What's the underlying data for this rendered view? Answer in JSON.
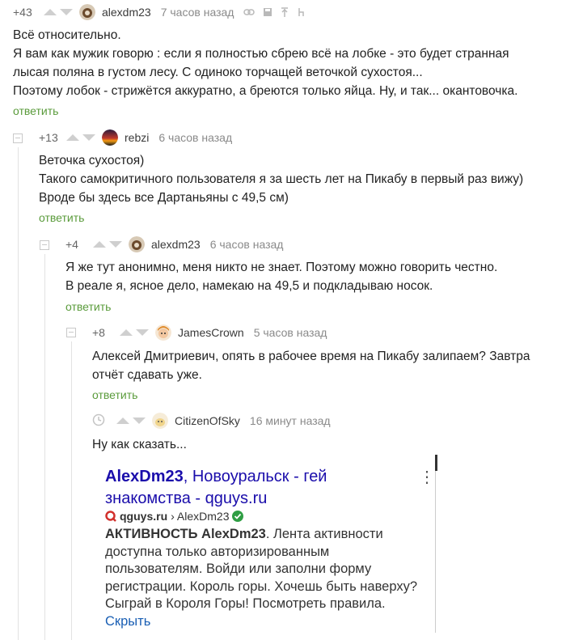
{
  "comments": [
    {
      "rating": "+43",
      "user": "alexdm23",
      "time": "7 часов назад",
      "lines": [
        "Всё относительно.",
        "Я вам как мужик говорю : если я полностью сбрею всё на лобке - это будет странная",
        "лысая поляна в густом лесу. С одиноко торчащей веточкой сухостоя...",
        "Поэтому лобок - стрижётся аккуратно, а бреются только яйца. Ну, и так... окантовочка."
      ],
      "reply": "ответить"
    },
    {
      "rating": "+13",
      "user": "rebzi",
      "time": "6 часов назад",
      "lines": [
        "Веточка сухостоя)",
        "Такого самокритичного пользователя я за шесть лет на Пикабу в первый раз вижу)",
        "Вроде бы здесь все Дартаньяны с 49,5 см)"
      ],
      "reply": "ответить"
    },
    {
      "rating": "+4",
      "user": "alexdm23",
      "time": "6 часов назад",
      "lines": [
        "Я же тут анонимно, меня никто не знает. Поэтому можно говорить честно.",
        "В реале я, ясное дело, намекаю на 49,5 и подкладываю носок."
      ],
      "reply": "ответить"
    },
    {
      "rating": "+8",
      "user": "JamesCrown",
      "time": "5 часов назад",
      "lines": [
        "Алексей Дмитриевич, опять в рабочее время на Пикабу залипаем? Завтра",
        "отчёт сдавать уже."
      ],
      "reply": "ответить"
    },
    {
      "rating": "",
      "user": "CitizenOfSky",
      "time": "16 минут назад",
      "lines": [
        "Ну как сказать..."
      ],
      "reply": ""
    }
  ],
  "screenshot": {
    "title_bold": "AlexDm23",
    "title_rest": ", Новоуральск - гей знакомства - qguys.ru",
    "site_domain": "qguys.ru",
    "site_path": " › AlexDm23",
    "desc_bold1": "АКТИВНОСТЬ",
    "desc_bold2": "AlexDm23",
    "desc_text": ". Лента активности доступна только авторизированным пользователям. Войди или заполни форму регистрации. Король горы. Хочешь быть наверху? Сыграй в Короля Горы! Посмотреть правила.",
    "hide_link": "Скрыть",
    "menu_glyph": "⋮"
  },
  "colors": {
    "reply_green": "#5a9b3b",
    "link_blue": "#1a0dab",
    "muted": "#8a8a8a"
  }
}
